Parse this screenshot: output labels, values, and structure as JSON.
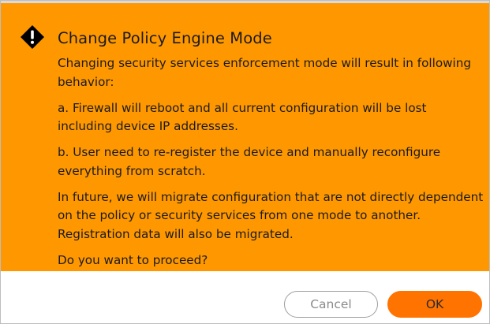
{
  "dialog": {
    "title": "Change Policy Engine Mode",
    "icon": "warning-diamond-icon",
    "paragraphs": [
      "Changing security services enforcement mode will result in following behavior:",
      "a. Firewall will reboot and all current configuration will be lost including device IP addresses.",
      "b. User need to re-register the device and manually reconfigure everything from scratch.",
      "In future, we will migrate configuration that are not directly dependent on the policy or security services from one mode to another. Registration data will also be migrated.",
      "Do you want to proceed?"
    ],
    "cancel_label": "Cancel",
    "ok_label": "OK"
  },
  "colors": {
    "warning_background": "#ff9800",
    "ok_button": "#ff7300",
    "cancel_text": "#8a8a8a"
  }
}
